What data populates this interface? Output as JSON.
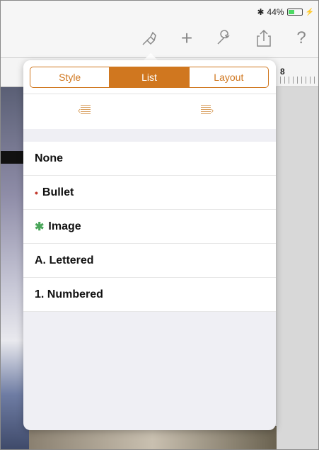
{
  "status": {
    "bluetooth": "✱",
    "battery_percent": "44%",
    "battery_level": 0.44
  },
  "toolbar": {
    "icons": [
      "paintbrush-icon",
      "add-icon",
      "wrench-icon",
      "share-icon",
      "help-icon"
    ],
    "add_glyph": "+",
    "help_glyph": "?"
  },
  "ruler": {
    "number": "8"
  },
  "popover": {
    "tabs": [
      {
        "label": "Style",
        "active": false
      },
      {
        "label": "List",
        "active": true
      },
      {
        "label": "Layout",
        "active": false
      }
    ],
    "list_styles": [
      {
        "label": "None",
        "marker": ""
      },
      {
        "label": "Bullet",
        "marker": "•"
      },
      {
        "label": "Image",
        "marker": "✱"
      },
      {
        "label": "A. Lettered",
        "marker": ""
      },
      {
        "label": "1. Numbered",
        "marker": ""
      }
    ]
  },
  "colors": {
    "accent": "#d0771f",
    "bullet": "#c23a2e",
    "image_marker": "#4aa65a"
  }
}
